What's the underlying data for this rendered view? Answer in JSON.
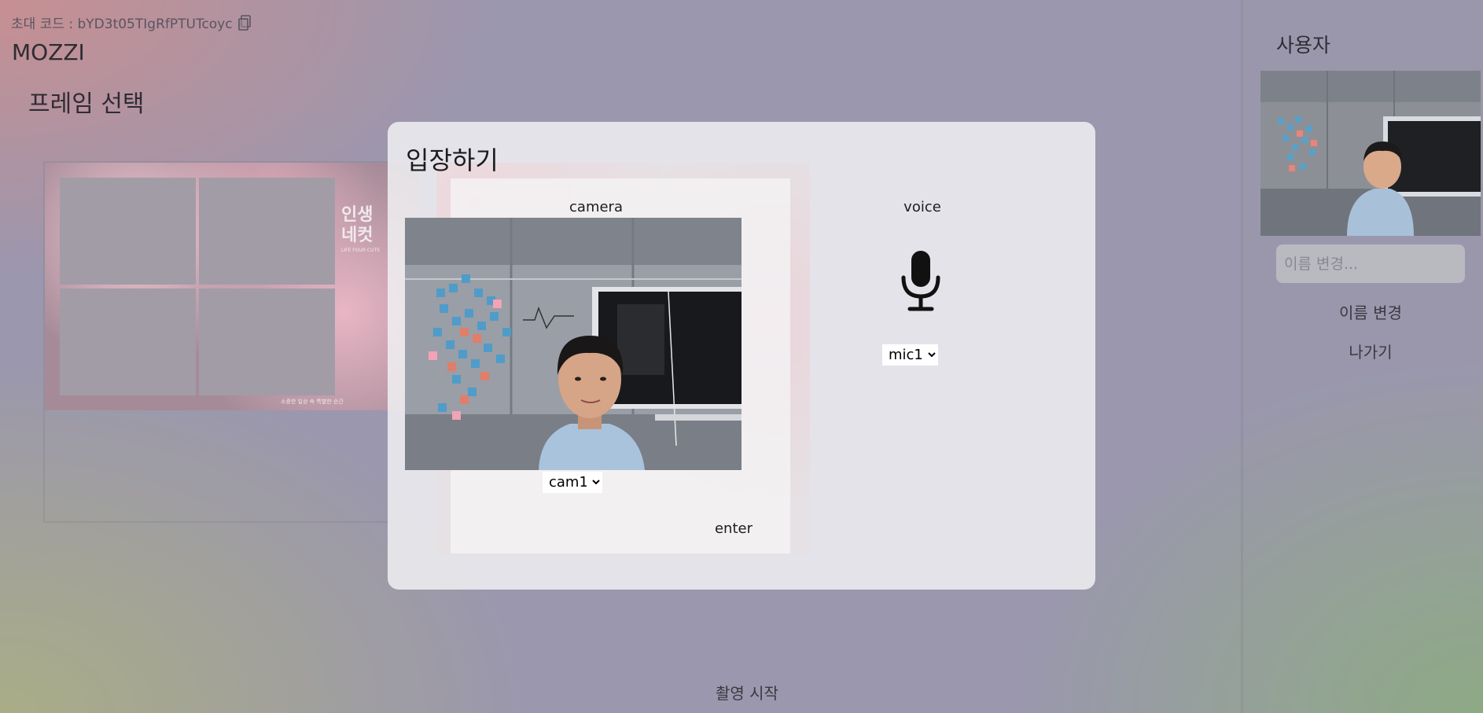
{
  "header": {
    "invite_code_text": "초대 코드 : bYD3t05TIgRfPTUTcoyc",
    "brand": "MOZZI",
    "frame_select_title": "프레임 선택"
  },
  "frame": {
    "label": "인생 네컷",
    "label_small": "LIFE FOUR CUTS",
    "footer_text": "소중한 일상 속 특별한 순간"
  },
  "side_panel": {
    "title": "사용자",
    "name_input_placeholder": "이름 변경...",
    "rename_button": "이름 변경",
    "leave_button": "나가기"
  },
  "modal": {
    "title": "입장하기",
    "camera_label": "camera",
    "voice_label": "voice",
    "camera_selected": "cam1",
    "camera_options": [
      "cam1"
    ],
    "mic_selected": "mic1",
    "mic_options": [
      "mic1"
    ],
    "enter_button": "enter"
  },
  "footer": {
    "start_capture_button": "촬영 시작"
  },
  "icons": {
    "copy": "copy-icon",
    "mic": "microphone-icon"
  }
}
